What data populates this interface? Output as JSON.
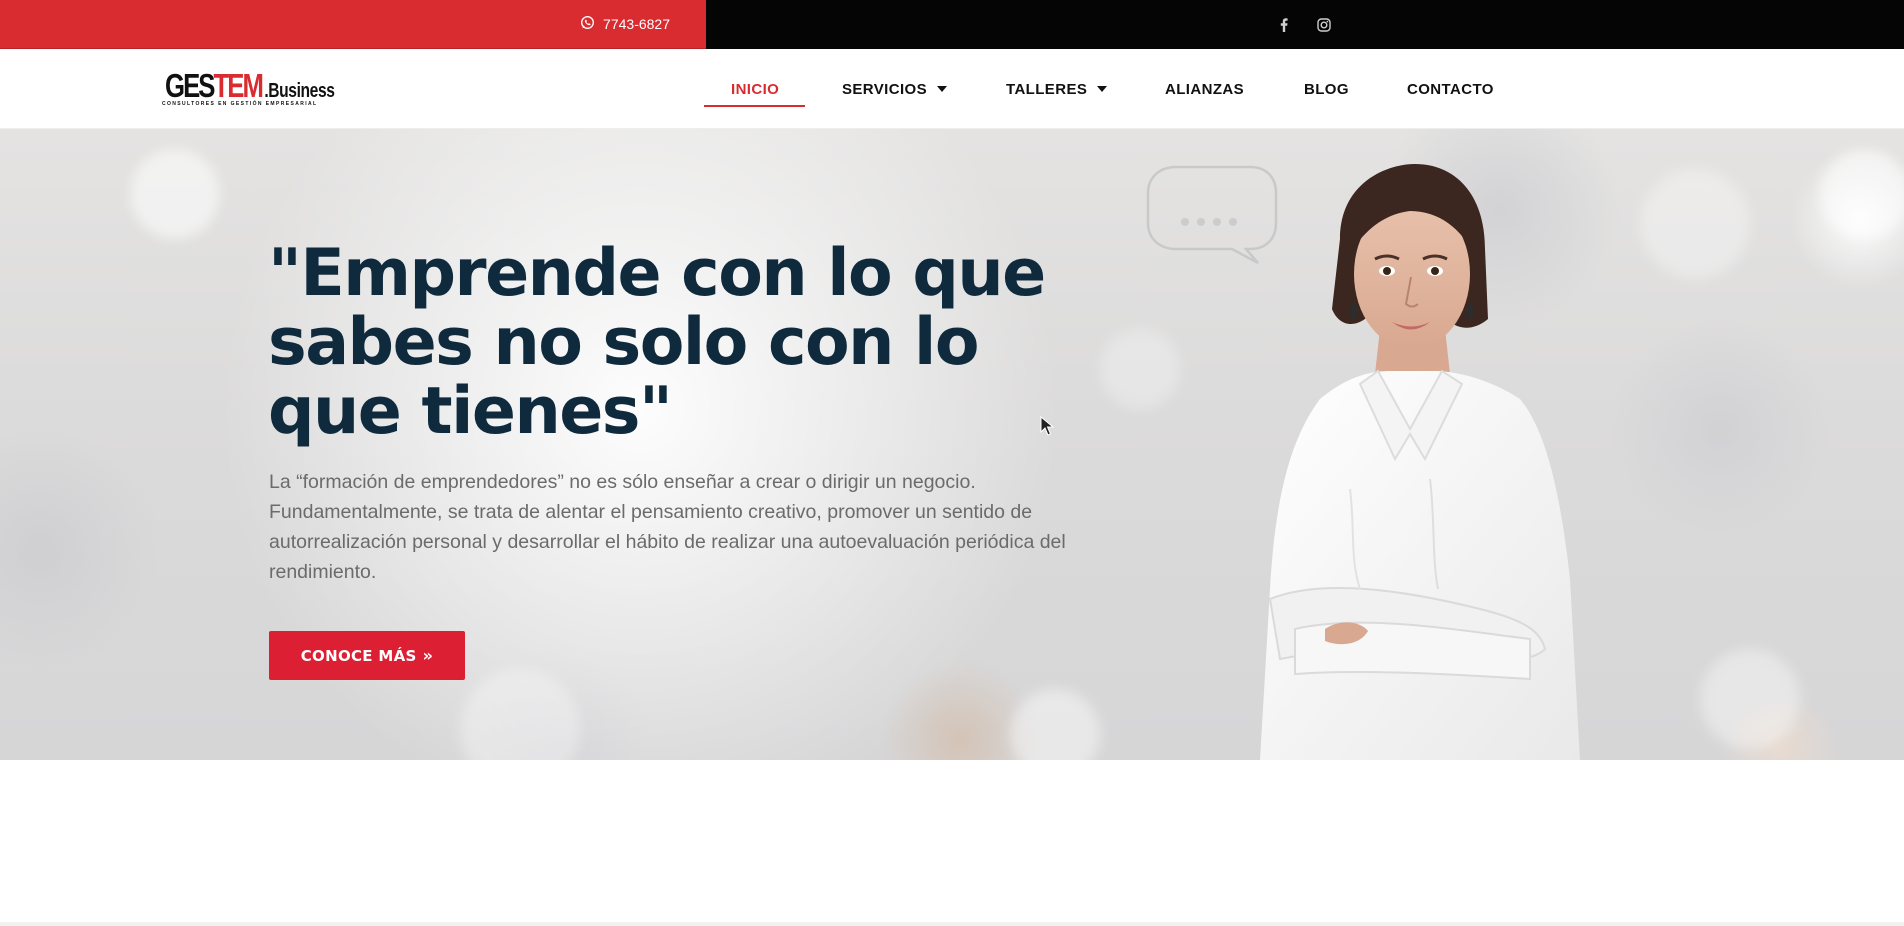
{
  "topbar": {
    "phone": "7743-6827",
    "phone_icon": "whatsapp-icon",
    "social_icons": [
      "facebook-icon",
      "instagram-icon"
    ],
    "colors": {
      "left": "#d92c31",
      "right": "#050505"
    }
  },
  "header": {
    "logo": {
      "main_left": "GES",
      "main_accent": "TEM",
      "main_right": ".Business",
      "tagline": "CONSULTORES EN GESTIÓN EMPRESARIAL"
    },
    "nav": {
      "inicio": "INICIO",
      "servicios": "SERVICIOS",
      "talleres": "TALLERES",
      "alianzas": "ALIANZAS",
      "blog": "BLOG",
      "contacto": "CONTACTO"
    },
    "active_item": "INICIO",
    "accent_color": "#d92c31"
  },
  "hero": {
    "headline": "\"Emprende con lo que sabes no solo con lo que tienes\"",
    "description": "La “formación de emprendedores” no es sólo enseñar a crear o dirigir un negocio. Fundamentalmente, se trata de alentar el pensamiento creativo, promover un sentido de autorrealización personal y desarrollar el hábito de realizar una autoevaluación periódica del rendimiento.",
    "cta_label": "CONOCE MÁS",
    "cta_icon": "double-chevron-right-icon",
    "headline_color": "#0f2a3d",
    "cta_color": "#dc1f33"
  }
}
